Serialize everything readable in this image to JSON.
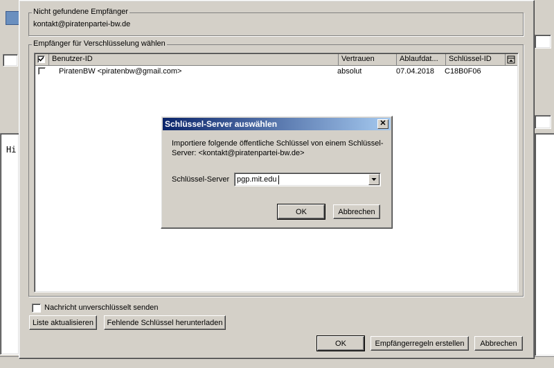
{
  "background": {
    "body_text": "Hi"
  },
  "not_found": {
    "group_label": "Nicht gefundene Empfänger",
    "email": "kontakt@piratenpartei-bw.de"
  },
  "recipients": {
    "group_label": "Empfänger für Verschlüsselung wählen",
    "columns": [
      "Benutzer-ID",
      "Vertrauen",
      "Ablaufdat...",
      "Schlüssel-ID"
    ],
    "rows": [
      {
        "checked": false,
        "user": "PiratenBW <piratenbw@gmail.com>",
        "trust": "absolut",
        "expiry": "07.04.2018",
        "key_id": "C18B0F06"
      }
    ]
  },
  "bottom": {
    "send_unencrypted_label": "Nachricht unverschlüsselt senden",
    "refresh_label": "Liste aktualisieren",
    "download_missing_label": "Fehlende Schlüssel herunterladen",
    "ok_label": "OK",
    "rules_label": "Empfängerregeln erstellen",
    "cancel_label": "Abbrechen"
  },
  "modal": {
    "title": "Schlüssel-Server auswählen",
    "message_line1": "Importiere folgende öffentliche Schlüssel von einem Schlüssel-",
    "message_line2": "Server: <kontakt@piratenpartei-bw.de>",
    "server_label": "Schlüssel-Server",
    "server_value": "pgp.mit.edu",
    "ok_label": "OK",
    "cancel_label": "Abbrechen"
  }
}
